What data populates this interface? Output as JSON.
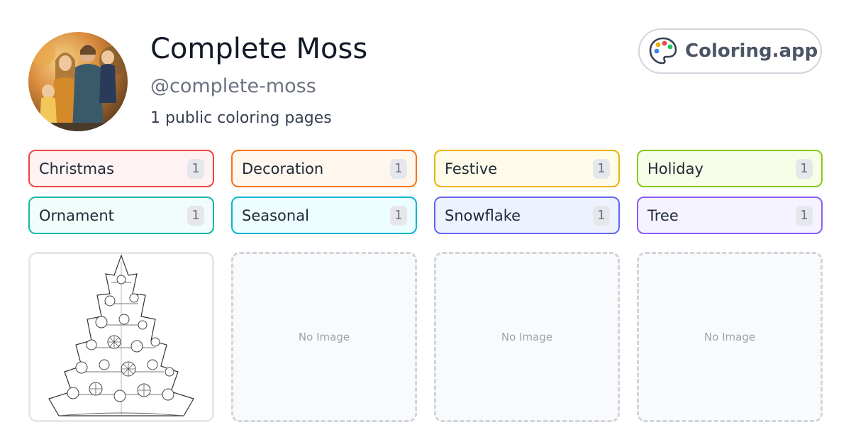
{
  "profile": {
    "name": "Complete Moss",
    "handle": "@complete-moss",
    "count_text": "1 public coloring pages"
  },
  "brand": {
    "label": "Coloring.app",
    "icon": "palette-icon"
  },
  "tags": [
    {
      "label": "Christmas",
      "count": "1",
      "border": "#ef4444",
      "bg": "#fef2f2"
    },
    {
      "label": "Decoration",
      "count": "1",
      "border": "#f97316",
      "bg": "#fff7ed"
    },
    {
      "label": "Festive",
      "count": "1",
      "border": "#eab308",
      "bg": "#fefce8"
    },
    {
      "label": "Holiday",
      "count": "1",
      "border": "#84cc16",
      "bg": "#f7fee7"
    },
    {
      "label": "Ornament",
      "count": "1",
      "border": "#14b8a6",
      "bg": "#f0fdfa"
    },
    {
      "label": "Seasonal",
      "count": "1",
      "border": "#06b6d4",
      "bg": "#ecfeff"
    },
    {
      "label": "Snowflake",
      "count": "1",
      "border": "#6366f1",
      "bg": "#eef2ff"
    },
    {
      "label": "Tree",
      "count": "1",
      "border": "#8b5cf6",
      "bg": "#f5f3ff"
    }
  ],
  "cards": [
    {
      "type": "image",
      "icon": "christmas-tree-coloring-image"
    },
    {
      "type": "empty",
      "label": "No Image"
    },
    {
      "type": "empty",
      "label": "No Image"
    },
    {
      "type": "empty",
      "label": "No Image"
    }
  ]
}
